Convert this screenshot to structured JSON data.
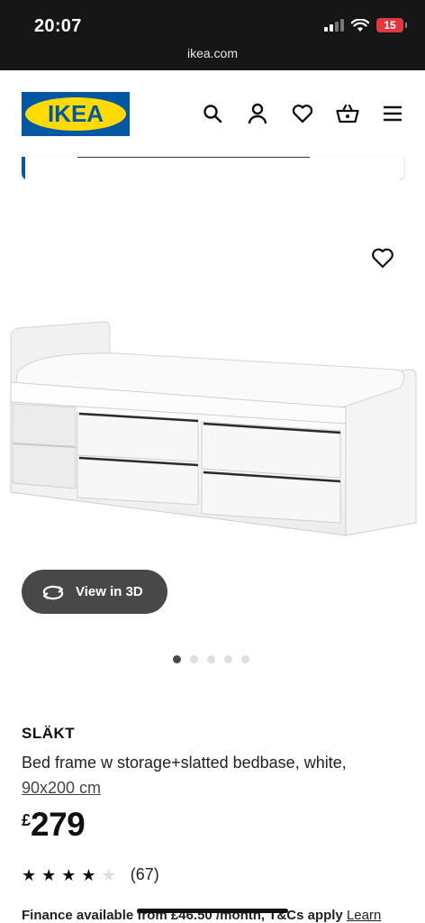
{
  "status_bar": {
    "time": "20:07",
    "battery": "15",
    "url": "ikea.com"
  },
  "header": {
    "logo_text": "IKEA",
    "icons": [
      "search-icon",
      "account-icon",
      "heart-icon",
      "basket-icon",
      "menu-icon"
    ]
  },
  "colors": {
    "brand_blue": "#0058a3",
    "brand_yellow": "#ffdb00",
    "status_bar_bg": "#161616",
    "button_dark": "#484848"
  },
  "gallery": {
    "view_3d_label": "View in 3D",
    "dot_count": 5,
    "active_dot": 1
  },
  "product": {
    "name": "SLÄKT",
    "description": "Bed frame w storage+slatted bedbase, white,",
    "size_link": "90x200 cm",
    "currency": "£",
    "price": "279",
    "rating_stars": 4,
    "rating_max": 5,
    "review_count": "(67)",
    "finance_text": "Finance available from £46.50 /month, T&Cs apply",
    "finance_link": "Learn"
  }
}
